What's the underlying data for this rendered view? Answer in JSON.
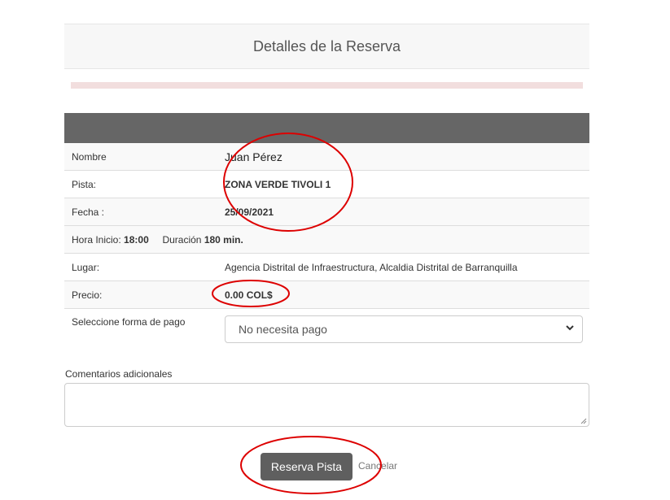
{
  "header": {
    "title": "Detalles de la Reserva"
  },
  "details": {
    "nombre_label": "Nombre",
    "nombre_value": "Juan Pérez",
    "pista_label": "Pista:",
    "pista_value": "ZONA VERDE TIVOLI 1",
    "fecha_label": "Fecha :",
    "fecha_value": "25/09/2021",
    "hora_label": "Hora Inicio:",
    "hora_value": "18:00",
    "duracion_label": "Duración",
    "duracion_value": "180 min.",
    "lugar_label": "Lugar:",
    "lugar_value": "Agencia Distrital de Infraestructura, Alcaldia Distrital de Barranquilla",
    "precio_label": "Precio:",
    "precio_value": "0.00 COL$"
  },
  "payment": {
    "label": "Seleccione forma de pago",
    "selected": "No necesita pago"
  },
  "comments": {
    "label": "Comentarios adicionales",
    "value": ""
  },
  "actions": {
    "submit_label": "Reserva Pista",
    "cancel_label": "Cancelar"
  },
  "icons": {
    "select": "chevron-down-icon",
    "textarea": "resize-grip-icon"
  },
  "colors": {
    "annotation": "#dd0000",
    "button": "#5f5f5f",
    "table_head": "#666666",
    "alert": "#f2dede"
  }
}
